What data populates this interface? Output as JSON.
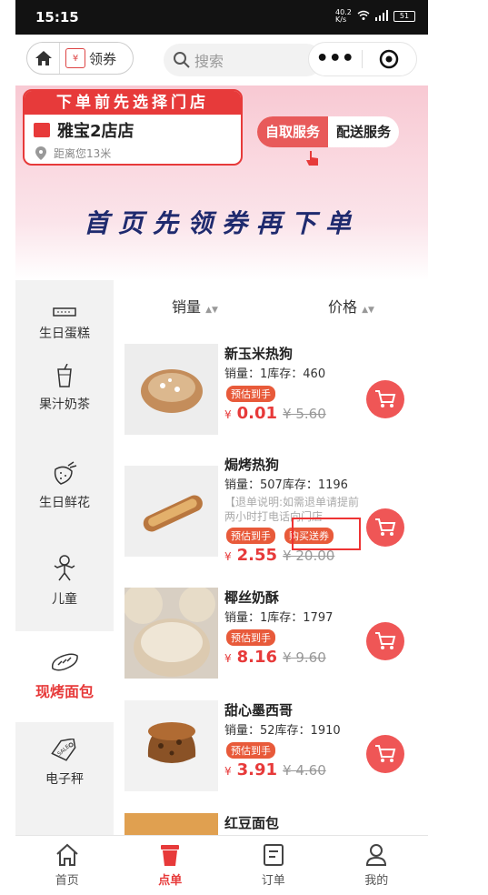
{
  "status": {
    "time": "15:15",
    "speed": "40.2 K/s",
    "battery": "51"
  },
  "nav": {
    "coupon_label": "领券",
    "coupon_box": "¥",
    "search_placeholder": "搜索"
  },
  "store": {
    "header": "下单前先选择门店",
    "name": "雅宝2店店",
    "distance": "距离您13米",
    "self_service": "自取服务",
    "delivery_service": "配送服务"
  },
  "banner": {
    "slogan": "首页先领券再下单"
  },
  "categories": [
    {
      "label": "生日蛋糕",
      "icon": "cake-icon"
    },
    {
      "label": "果汁奶茶",
      "icon": "drink-icon"
    },
    {
      "label": "生日鲜花",
      "icon": "strawberry-icon"
    },
    {
      "label": "儿童",
      "icon": "child-icon"
    },
    {
      "label": "现烤面包",
      "icon": "bread-icon"
    },
    {
      "label": "电子秤",
      "icon": "sale-tag-icon"
    }
  ],
  "sort": {
    "sales": "销量",
    "price": "价格"
  },
  "products": [
    {
      "name": "新玉米热狗",
      "meta": "销量：1库存：460",
      "note": "",
      "tag1": "预估到手",
      "tag2": "",
      "symbol": "¥",
      "price": "0.01",
      "old_price": "¥ 5.60"
    },
    {
      "name": "焗烤热狗",
      "meta": "销量：507库存：1196",
      "note": "【退单说明:如需退单请提前两小时打电话向门店",
      "tag1": "预估到手",
      "tag2": "购买送券",
      "symbol": "¥",
      "price": "2.55",
      "old_price": "¥ 20.00"
    },
    {
      "name": "椰丝奶酥",
      "meta": "销量：1库存：1797",
      "note": "",
      "tag1": "预估到手",
      "tag2": "",
      "symbol": "¥",
      "price": "8.16",
      "old_price": "¥ 9.60"
    },
    {
      "name": "甜心墨西哥",
      "meta": "销量：52库存：1910",
      "note": "",
      "tag1": "预估到手",
      "tag2": "",
      "symbol": "¥",
      "price": "3.91",
      "old_price": "¥ 4.60"
    },
    {
      "name": "红豆面包"
    }
  ],
  "tabs": [
    {
      "label": "首页",
      "icon": "home-icon"
    },
    {
      "label": "点单",
      "icon": "cup-icon"
    },
    {
      "label": "订单",
      "icon": "order-icon"
    },
    {
      "label": "我的",
      "icon": "profile-icon"
    }
  ],
  "colors": {
    "accent": "#e73a3a",
    "navy": "#1f2a6e"
  }
}
